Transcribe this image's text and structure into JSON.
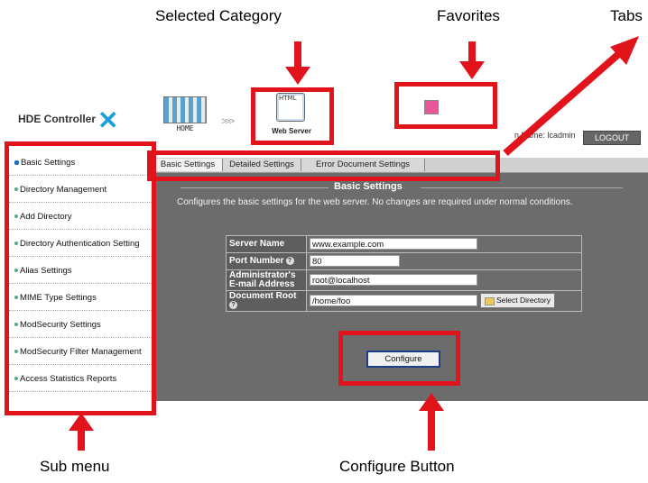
{
  "annotations": {
    "selected_category": "Selected Category",
    "favorites": "Favorites",
    "tabs": "Tabs",
    "sub_menu": "Sub menu",
    "configure_button": "Configure Button"
  },
  "header": {
    "logo_text": "HDE Controller",
    "home_label": "HOME",
    "category_label": "Web Server",
    "category_icon_text": "HTML",
    "login_text": "n Name: lcadmin",
    "logout_label": "LOGOUT"
  },
  "sidebar": {
    "items": [
      {
        "label": "Basic Settings"
      },
      {
        "label": "Directory Management"
      },
      {
        "label": "Add Directory"
      },
      {
        "label": "Directory Authentication Setting"
      },
      {
        "label": "Alias Settings"
      },
      {
        "label": "MIME Type Settings"
      },
      {
        "label": "ModSecurity Settings"
      },
      {
        "label": "ModSecurity Filter Management"
      },
      {
        "label": "Access Statistics Reports"
      }
    ]
  },
  "tabs": [
    {
      "label": "Basic Settings"
    },
    {
      "label": "Detailed Settings"
    },
    {
      "label": "Error Document Settings"
    }
  ],
  "main": {
    "section_title": "Basic Settings",
    "description": "Configures the basic settings for the web server. No changes are required under normal conditions.",
    "form": {
      "server_name_label": "Server Name",
      "server_name_value": "www.example.com",
      "port_label": "Port Number",
      "port_value": "80",
      "admin_email_label": "Administrator's E-mail Address",
      "admin_email_value": "root@localhost",
      "doc_root_label": "Document Root",
      "doc_root_value": "/home/foo",
      "select_directory_label": "Select Directory"
    },
    "configure_label": "Configure"
  },
  "colors": {
    "annotation_red": "#e0141a",
    "content_bg": "#6c6c6c",
    "accent_blue": "#1a9fd8"
  }
}
